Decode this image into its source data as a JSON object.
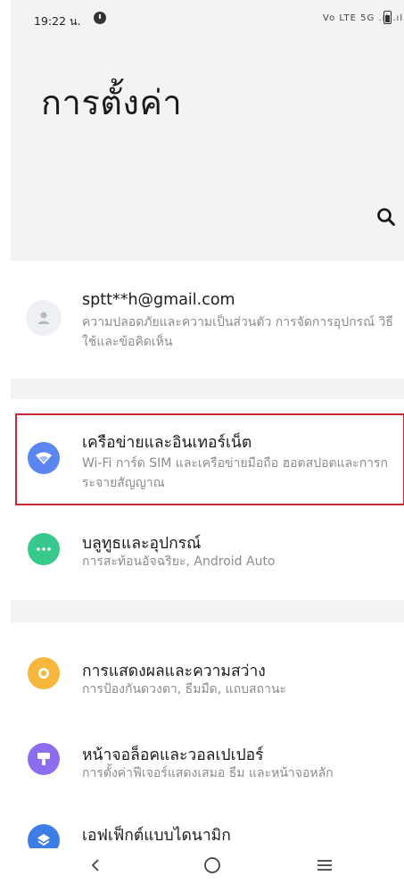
{
  "status_bar": {
    "time": "19:22 น.",
    "network": "Vo LTE 5G .ıl .ıl"
  },
  "header": {
    "title": "การตั้งค่า"
  },
  "account": {
    "email": "sptt**h@gmail.com",
    "subtitle": "ความปลอดภัยและความเป็นส่วนตัว การจัดการอุปกรณ์ วิธีใช้และข้อคิดเห็น"
  },
  "items": [
    {
      "title": "เครือข่ายและอินเทอร์เน็ต",
      "subtitle": "Wi-Fi การ์ด SIM และเครือข่ายมือถือ ฮอตสปอตและการกระจายสัญญาณ",
      "icon": "wifi-icon",
      "color": "#5b86f0"
    },
    {
      "title": "บลูทูธและอุปกรณ์",
      "subtitle": "การสะท้อนอัจฉริยะ, Android Auto",
      "icon": "more-dots-icon",
      "color": "#37c98c"
    },
    {
      "title": "การแสดงผลและความสว่าง",
      "subtitle": "การป้องกันดวงตา, ธีมมืด, แถบสถานะ",
      "icon": "sun-icon",
      "color": "#f6b73c"
    },
    {
      "title": "หน้าจอล็อคและวอลเปเปอร์",
      "subtitle": "การตั้งค่าฟีเจอร์แสดงเสมอ ธีม และหน้าจอหลัก",
      "icon": "brush-icon",
      "color": "#8c6df0"
    },
    {
      "title": "เอฟเฟ็กต์แบบไดนามิก",
      "subtitle": "",
      "icon": "layers-icon",
      "color": "#3f7de6"
    }
  ],
  "accent": {
    "highlight": "#c52a35"
  }
}
